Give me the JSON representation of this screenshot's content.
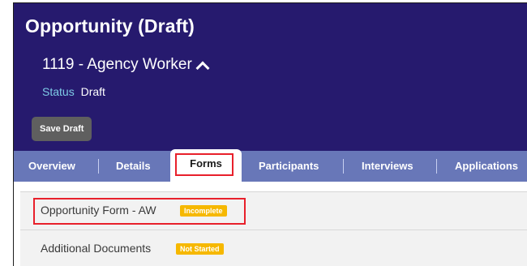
{
  "header": {
    "title": "Opportunity (Draft)",
    "record_name": "1119 - Agency Worker",
    "status_label": "Status",
    "status_value": "Draft",
    "save_label": "Save Draft"
  },
  "tabs": [
    {
      "label": "Overview"
    },
    {
      "label": "Details"
    },
    {
      "label": "Forms",
      "active": true
    },
    {
      "label": "Participants"
    },
    {
      "label": "Interviews"
    },
    {
      "label": "Applications"
    }
  ],
  "forms": [
    {
      "name": "Opportunity Form - AW",
      "status": "Incomplete"
    },
    {
      "name": "Additional Documents",
      "status": "Not Started"
    }
  ],
  "colors": {
    "header_bg": "#261a6e",
    "tabbar_bg": "#6877b8",
    "status_label": "#7ecbe6",
    "badge": "#f6b800",
    "highlight": "#e8202b"
  }
}
